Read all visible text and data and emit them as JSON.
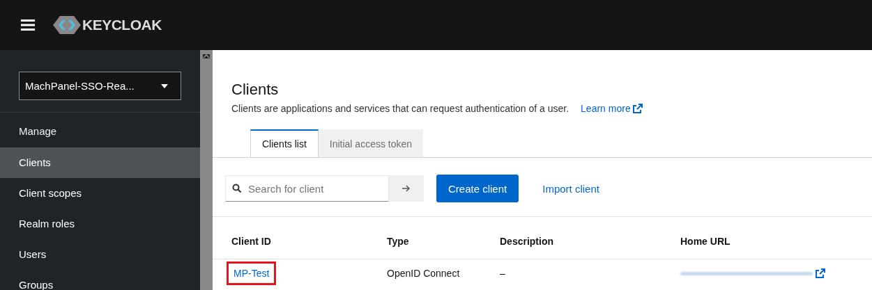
{
  "header": {
    "logo_text": "KEYCLOAK"
  },
  "sidebar": {
    "realm": "MachPanel-SSO-Rea...",
    "items": [
      {
        "label": "Manage",
        "kind": "heading",
        "selected": false
      },
      {
        "label": "Clients",
        "kind": "link",
        "selected": true
      },
      {
        "label": "Client scopes",
        "kind": "link",
        "selected": false
      },
      {
        "label": "Realm roles",
        "kind": "link",
        "selected": false
      },
      {
        "label": "Users",
        "kind": "link",
        "selected": false
      },
      {
        "label": "Groups",
        "kind": "link",
        "selected": false
      }
    ]
  },
  "page": {
    "title": "Clients",
    "description": "Clients are applications and services that can request authentication of a user.",
    "learn_more": "Learn more"
  },
  "tabs": [
    {
      "label": "Clients list",
      "selected": true
    },
    {
      "label": "Initial access token",
      "selected": false
    }
  ],
  "toolbar": {
    "search_placeholder": "Search for client",
    "create_button": "Create client",
    "import_link": "Import client"
  },
  "table": {
    "columns": [
      "Client ID",
      "Type",
      "Description",
      "Home URL"
    ],
    "rows": [
      {
        "client_id": "MP-Test",
        "type": "OpenID Connect",
        "description": "–",
        "highlighted": true
      }
    ]
  }
}
